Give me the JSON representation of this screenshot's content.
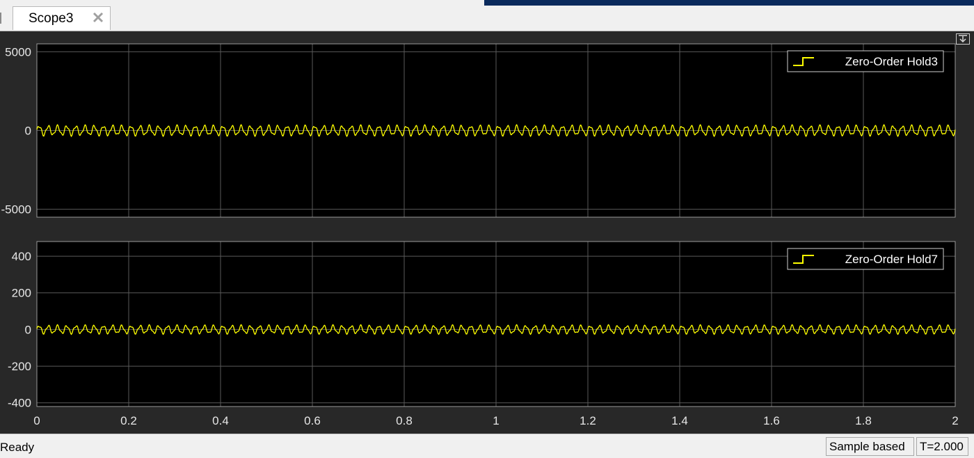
{
  "window": {
    "tab_label": "Scope3"
  },
  "status_bar": {
    "status": "Ready",
    "mode": "Sample based",
    "time": "T=2.000"
  },
  "colors": {
    "signal": "#ffff00",
    "axes_background": "#000000",
    "figure_background": "#282828",
    "grid": "#5a5a5a"
  },
  "icons": {
    "tab_close": "close-icon",
    "undock": "undock-arrow-icon",
    "legend_marker": "stair-step-line-icon"
  },
  "chart_data": [
    {
      "type": "line",
      "series": [
        {
          "name": "Zero-Order Hold3",
          "color": "#ffff00",
          "oscillation_amplitude": 350,
          "oscillation_cycles": 100
        }
      ],
      "xlim": [
        0,
        2
      ],
      "ylim": [
        -5500,
        5500
      ],
      "yticks": [
        5000,
        0,
        -5000
      ],
      "xticks": [],
      "grid": true,
      "legend_placement": "top-right"
    },
    {
      "type": "line",
      "series": [
        {
          "name": "Zero-Order Hold7",
          "color": "#ffff00",
          "oscillation_amplitude": 25,
          "oscillation_cycles": 100
        }
      ],
      "xlim": [
        0,
        2
      ],
      "ylim": [
        -420,
        480
      ],
      "yticks": [
        400,
        200,
        0,
        -200,
        -400
      ],
      "xticks": [
        0,
        0.2,
        0.4,
        0.6,
        0.8,
        1,
        1.2,
        1.4,
        1.6,
        1.8,
        2
      ],
      "grid": true,
      "legend_placement": "top-right"
    }
  ]
}
